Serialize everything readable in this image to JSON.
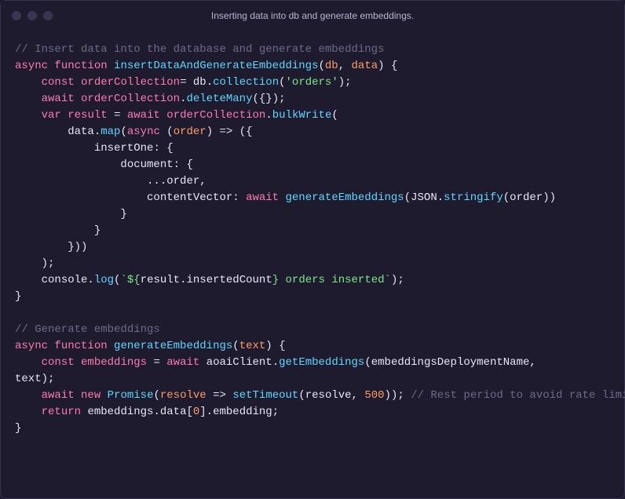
{
  "window": {
    "title": "Inserting data into db and generate embeddings."
  },
  "code": {
    "comment1": "// Insert data into the database and generate embeddings",
    "comment2": "// Generate embeddings",
    "comment3": "// Rest period to avoid rate limiting on Azure OpenAI",
    "kw_async": "async",
    "kw_function": "function",
    "kw_const": "const",
    "kw_await": "await",
    "kw_var": "var",
    "kw_new": "new",
    "kw_return": "return",
    "fn_insert": "insertDataAndGenerateEmbeddings",
    "fn_generate": "generateEmbeddings",
    "param_db": "db",
    "param_data": "data",
    "param_order": "order",
    "param_text": "text",
    "param_resolve": "resolve",
    "var_orderCollection": "orderCollection",
    "var_result": "result",
    "var_embeddings": "embeddings",
    "var_aoaiClient": "aoaiClient",
    "var_embeddingsDeploymentName": "embeddingsDeploymentName",
    "var_console": "console",
    "var_JSON": "JSON",
    "var_Promise": "Promise",
    "var_setTimeout": "setTimeout",
    "m_collection": "collection",
    "m_deleteMany": "deleteMany",
    "m_bulkWrite": "bulkWrite",
    "m_map": "map",
    "m_log": "log",
    "m_getEmbeddings": "getEmbeddings",
    "m_stringify": "stringify",
    "prop_insertOne": "insertOne",
    "prop_document": "document",
    "prop_contentVector": "contentVector",
    "prop_insertedCount": "insertedCount",
    "prop_data": "data",
    "prop_embedding": "embedding",
    "str_orders": "'orders'",
    "tmpl_open": "`${",
    "tmpl_close": "} orders inserted`",
    "num_500": "500",
    "num_0": "0",
    "arrow": "=>"
  }
}
